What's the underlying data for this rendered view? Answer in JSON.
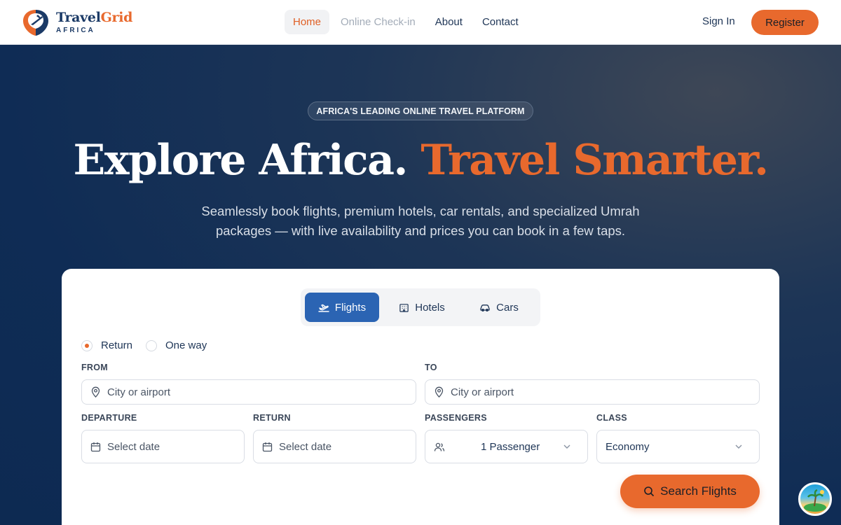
{
  "brand": {
    "name_primary": "Travel",
    "name_secondary": "Grid",
    "tagline": "AFRICA",
    "accent": "#e8692d",
    "navy": "#1b3a66"
  },
  "nav": {
    "links": [
      {
        "label": "Home",
        "state": "active"
      },
      {
        "label": "Online Check-in",
        "state": "muted"
      },
      {
        "label": "About",
        "state": "normal"
      },
      {
        "label": "Contact",
        "state": "normal"
      }
    ],
    "sign_in": "Sign In",
    "register": "Register"
  },
  "hero": {
    "badge": "AFRICA'S LEADING ONLINE TRAVEL PLATFORM",
    "headline_white": "Explore Africa. ",
    "headline_accent": "Travel Smarter.",
    "subtitle": "Seamlessly book flights, premium hotels, car rentals, and specialized Umrah packages — with live availability and prices you can book in a few taps."
  },
  "search": {
    "tabs": [
      {
        "label": "Flights",
        "icon": "plane-icon",
        "active": true
      },
      {
        "label": "Hotels",
        "icon": "building-icon",
        "active": false
      },
      {
        "label": "Cars",
        "icon": "car-icon",
        "active": false
      }
    ],
    "trip_type": {
      "options": [
        "Return",
        "One way"
      ],
      "selected": "Return"
    },
    "from": {
      "label": "FROM",
      "placeholder": "City or airport"
    },
    "to": {
      "label": "TO",
      "placeholder": "City or airport"
    },
    "departure": {
      "label": "DEPARTURE",
      "placeholder": "Select date"
    },
    "return": {
      "label": "RETURN",
      "placeholder": "Select date"
    },
    "passengers": {
      "label": "PASSENGERS",
      "value": "1 Passenger"
    },
    "class": {
      "label": "CLASS",
      "value": "Economy"
    },
    "submit": "Search Flights",
    "submit_color": "#e8692d",
    "tab_active_color": "#2b64b3"
  },
  "chat": {
    "icon": "island-avatar-icon"
  }
}
